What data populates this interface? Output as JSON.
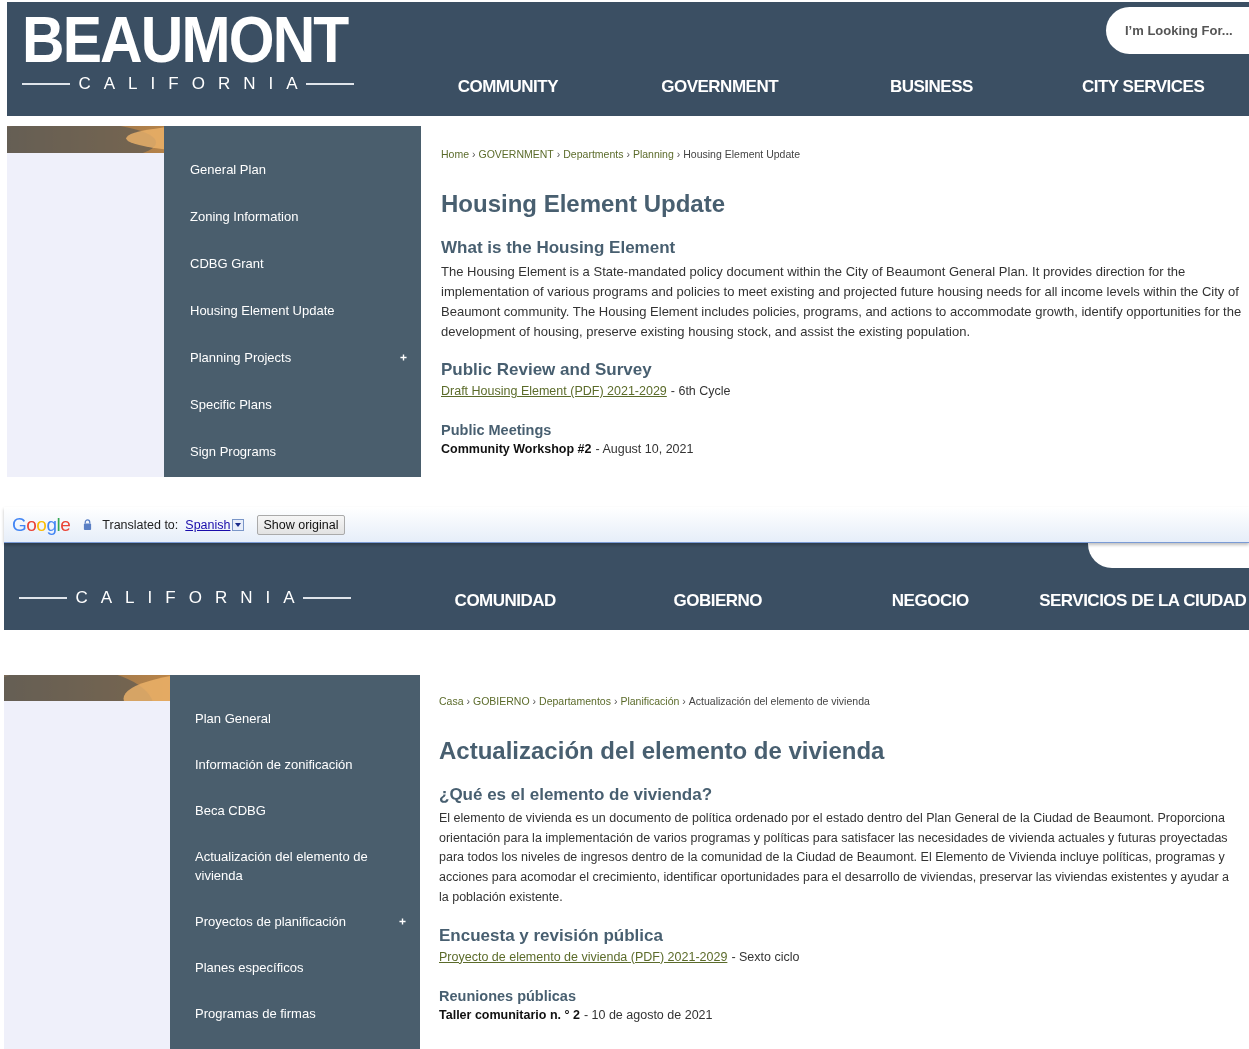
{
  "panels": [
    {
      "header": {
        "logo_title": "BEAUMONT",
        "logo_subtitle": "CALIFORNIA",
        "search_placeholder": "I’m Looking For...",
        "nav": [
          "COMMUNITY",
          "GOVERNMENT",
          "BUSINESS",
          "CITY SERVICES"
        ]
      },
      "sidebar": {
        "items": [
          {
            "label": "General Plan",
            "expandable": false
          },
          {
            "label": "Zoning Information",
            "expandable": false
          },
          {
            "label": "CDBG Grant",
            "expandable": false
          },
          {
            "label": "Housing Element Update",
            "expandable": false
          },
          {
            "label": "Planning Projects",
            "expandable": true
          },
          {
            "label": "Specific Plans",
            "expandable": false
          },
          {
            "label": "Sign Programs",
            "expandable": false
          }
        ]
      },
      "content": {
        "breadcrumb": [
          {
            "label": "Home",
            "current": false,
            "separator": "›"
          },
          {
            "label": "GOVERNMENT",
            "current": false,
            "separator": "›"
          },
          {
            "label": "Departments",
            "current": false,
            "separator": "›"
          },
          {
            "label": "Planning",
            "current": false,
            "separator": "›"
          },
          {
            "label": "Housing Element Update",
            "current": true
          }
        ],
        "title": "Housing Element Update",
        "intro": {
          "heading": "What is the Housing Element",
          "text": "The Housing Element is a State-mandated policy document within the City of Beaumont General Plan.  It provides direction for the implementation of various programs and policies to meet existing and projected future housing needs for all income levels within the City of Beaumont community.  The Housing Element includes policies, programs, and actions to accommodate growth, identify opportunities for the development of housing, preserve existing housing stock, and assist the existing population."
        },
        "review": {
          "heading": "Public Review and Survey",
          "link": "Draft Housing Element (PDF) 2021-2029",
          "note": "- 6th Cycle"
        },
        "meetings": {
          "heading": "Public Meetings",
          "event": "Community Workshop #2",
          "date": "- August 10, 2021"
        }
      }
    },
    {
      "header": {
        "logo_subtitle": "CALIFORNIA",
        "nav": [
          "COMUNIDAD",
          "GOBIERNO",
          "NEGOCIO",
          "SERVICIOS DE LA CIUDAD"
        ]
      },
      "sidebar": {
        "items": [
          {
            "label": "Plan General",
            "expandable": false
          },
          {
            "label": "Información de zonificación",
            "expandable": false
          },
          {
            "label": "Beca CDBG",
            "expandable": false
          },
          {
            "label": "Actualización del elemento de vivienda",
            "expandable": false
          },
          {
            "label": "Proyectos de planificación",
            "expandable": true
          },
          {
            "label": "Planes específicos",
            "expandable": false
          },
          {
            "label": "Programas de firmas",
            "expandable": false
          }
        ]
      },
      "content": {
        "breadcrumb": [
          {
            "label": "Casa",
            "current": false,
            "separator": "›"
          },
          {
            "label": "GOBIERNO",
            "current": false,
            "separator": "›"
          },
          {
            "label": "Departamentos",
            "current": false,
            "separator": "›"
          },
          {
            "label": "Planificación",
            "current": false,
            "separator": "›"
          },
          {
            "label": "Actualización del elemento de vivienda",
            "current": true
          }
        ],
        "title": "Actualización del elemento de vivienda",
        "intro": {
          "heading": "¿Qué es el elemento de vivienda?",
          "text": "El elemento de vivienda es un documento de política ordenado por el estado dentro del Plan General de la Ciudad de Beaumont. Proporciona orientación para la implementación de varios programas y políticas para satisfacer las necesidades de vivienda actuales y futuras proyectadas para todos los niveles de ingresos dentro de la comunidad de la Ciudad de Beaumont. El Elemento de Vivienda incluye políticas, programas y acciones para acomodar el crecimiento, identificar oportunidades para el desarrollo de viviendas, preservar las viviendas existentes y ayudar a la población existente."
        },
        "review": {
          "heading": "Encuesta y revisión pública",
          "link": "Proyecto de elemento de vivienda (PDF) 2021-2029",
          "note": "- Sexto ciclo"
        },
        "meetings": {
          "heading": "Reuniones públicas",
          "event": "Taller comunitario n. ° 2",
          "date": "- 10 de agosto de 2021"
        }
      }
    }
  ],
  "translate_bar": {
    "brand": "Google",
    "label": "Translated to:",
    "language": "Spanish",
    "button": "Show original"
  }
}
